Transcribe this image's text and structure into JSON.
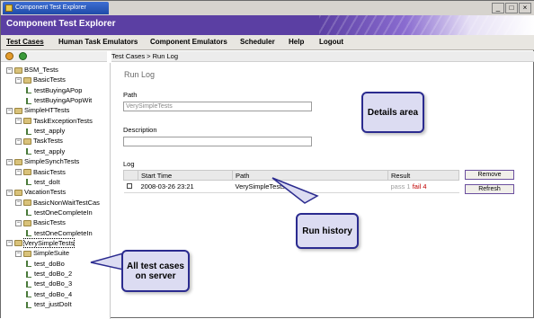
{
  "window": {
    "os_tab_title": "Component Test Explorer",
    "controls": [
      "_",
      "□",
      "×"
    ]
  },
  "app": {
    "title": "Component Test Explorer"
  },
  "menu": {
    "items": [
      "Test Cases",
      "Human Task Emulators",
      "Component Emulators",
      "Scheduler",
      "Help",
      "Logout"
    ]
  },
  "toolbar": {
    "icons": [
      "refresh-icon",
      "run-icon"
    ]
  },
  "tree": {
    "nodes": [
      {
        "label": "BSM_Tests",
        "level": 0,
        "type": "project"
      },
      {
        "label": "BasicTests",
        "level": 1,
        "type": "suite"
      },
      {
        "label": "testBuyingAPop",
        "level": 2,
        "type": "test"
      },
      {
        "label": "testBuyingAPopWit",
        "level": 2,
        "type": "test"
      },
      {
        "label": "SimpleHTTests",
        "level": 0,
        "type": "project"
      },
      {
        "label": "TaskExceptionTests",
        "level": 1,
        "type": "suite"
      },
      {
        "label": "test_apply",
        "level": 2,
        "type": "test"
      },
      {
        "label": "TaskTests",
        "level": 1,
        "type": "suite"
      },
      {
        "label": "test_apply",
        "level": 2,
        "type": "test"
      },
      {
        "label": "SimpleSynchTests",
        "level": 0,
        "type": "project"
      },
      {
        "label": "BasicTests",
        "level": 1,
        "type": "suite"
      },
      {
        "label": "test_doIt",
        "level": 2,
        "type": "test"
      },
      {
        "label": "VacationTests",
        "level": 0,
        "type": "project"
      },
      {
        "label": "BasicNonWaitTestCas",
        "level": 1,
        "type": "suite"
      },
      {
        "label": "testOneCompleteIn",
        "level": 2,
        "type": "test"
      },
      {
        "label": "BasicTests",
        "level": 1,
        "type": "suite"
      },
      {
        "label": "testOneCompleteIn",
        "level": 2,
        "type": "test"
      },
      {
        "label": "VerySimpleTests",
        "level": 0,
        "type": "project",
        "selected": true
      },
      {
        "label": "SimpleSuite",
        "level": 1,
        "type": "suite"
      },
      {
        "label": "test_doBo",
        "level": 2,
        "type": "test"
      },
      {
        "label": "test_doBo_2",
        "level": 2,
        "type": "test"
      },
      {
        "label": "test_doBo_3",
        "level": 2,
        "type": "test"
      },
      {
        "label": "test_doBo_4",
        "level": 2,
        "type": "test"
      },
      {
        "label": "test_justDoIt",
        "level": 2,
        "type": "test"
      }
    ]
  },
  "breadcrumb": "Test Cases > Run Log",
  "runlog": {
    "title": "Run Log",
    "path_label": "Path",
    "path_value": "VerySimpleTests",
    "description_label": "Description",
    "description_value": "",
    "log_label": "Log",
    "columns": [
      "",
      "Start Time",
      "Path",
      "Result"
    ],
    "rows": [
      {
        "start_time": "2008-03-26 23:21",
        "path": "VerySimpleTests",
        "pass": "pass 1",
        "fail": "fail 4"
      }
    ],
    "buttons": {
      "remove": "Remove",
      "refresh": "Refresh"
    }
  },
  "callouts": {
    "details": "Details area",
    "run_history": "Run history",
    "all_tests": "All test cases on server"
  },
  "colors": {
    "header": "#5b3fa3",
    "fail": "#c00000",
    "callout_border": "#2b2b8f"
  }
}
